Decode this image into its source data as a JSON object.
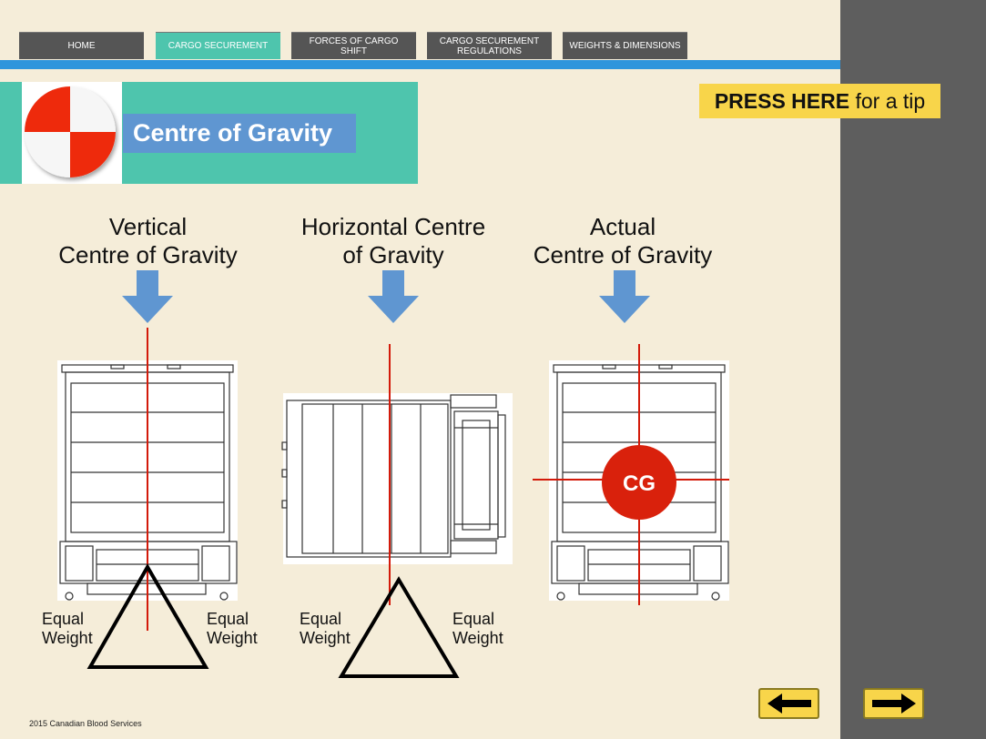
{
  "nav": {
    "items": [
      {
        "label": "HOME"
      },
      {
        "label": "CARGO SECUREMENT"
      },
      {
        "label": "FORCES OF CARGO SHIFT"
      },
      {
        "label": "CARGO SECUREMENT REGULATIONS"
      },
      {
        "label": "WEIGHTS & DIMENSIONS"
      }
    ],
    "active_index": 1
  },
  "page": {
    "title": "Centre of Gravity"
  },
  "tip": {
    "bold": "PRESS HERE",
    "rest": " for a tip"
  },
  "panels": {
    "vertical": {
      "heading_line1": "Vertical",
      "heading_line2": "Centre of Gravity",
      "left_line1": "Equal",
      "left_line2": "Weight",
      "right_line1": "Equal",
      "right_line2": "Weight"
    },
    "horizontal": {
      "heading_line1": "Horizontal  Centre",
      "heading_line2": "of Gravity",
      "left_line1": "Equal",
      "left_line2": "Weight",
      "right_line1": "Equal",
      "right_line2": "Weight"
    },
    "actual": {
      "heading_line1": "Actual",
      "heading_line2": "Centre of Gravity",
      "cg_label": "CG"
    }
  },
  "footer": {
    "text": "2015 Canadian Blood Services"
  },
  "icons": {
    "logo": "centre-of-gravity-symbol-icon",
    "prev": "arrow-left-icon",
    "next": "arrow-right-icon",
    "down_arrow": "arrow-down-icon"
  },
  "colors": {
    "background": "#f5edd9",
    "sidebar": "#5e5e5e",
    "nav": "#555555",
    "nav_active": "#4ec5ad",
    "accent_blue": "#2f95dc",
    "title_label": "#5f96d1",
    "tip": "#f8d54a",
    "red": "#e8230c",
    "cg_circle": "#d9210c"
  }
}
